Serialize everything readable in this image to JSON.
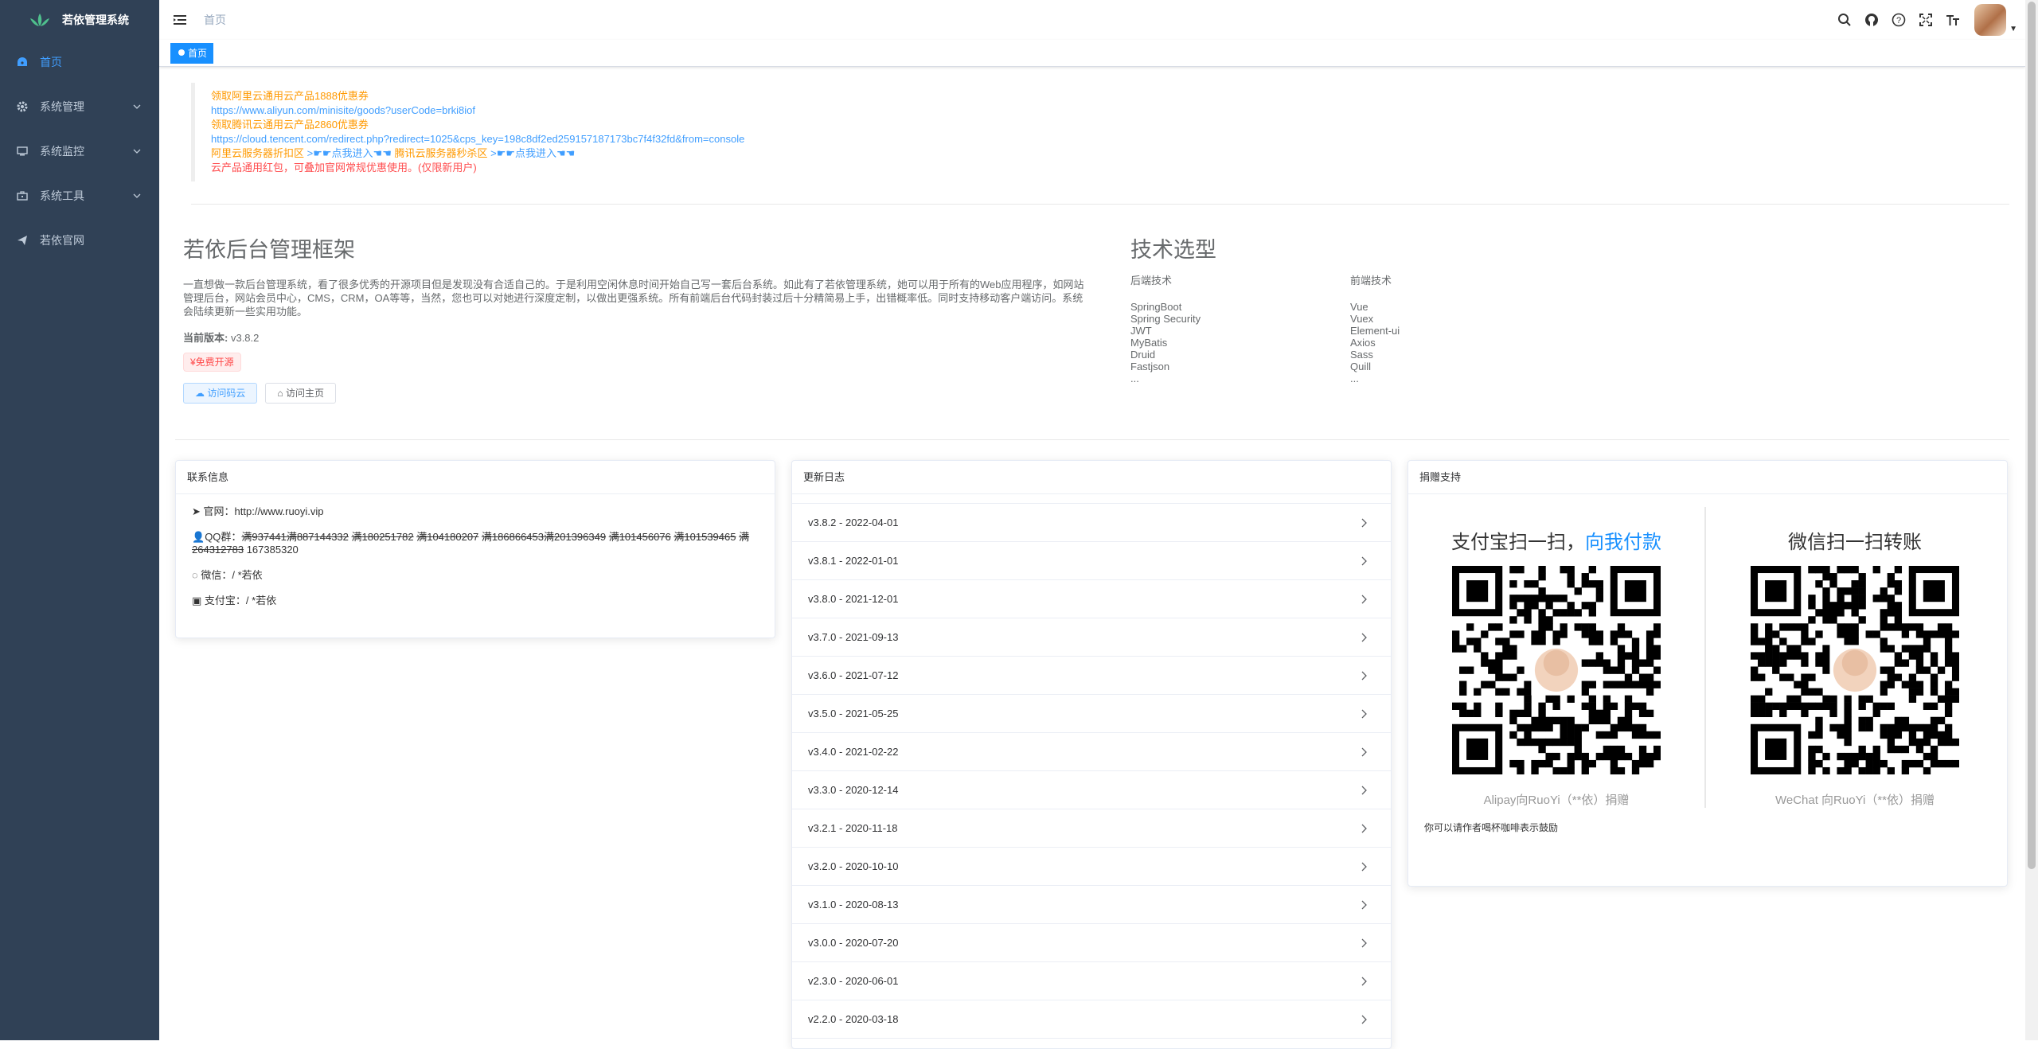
{
  "app": {
    "title": "若依管理系统"
  },
  "sidebar": {
    "items": [
      {
        "label": "首页",
        "icon": "dashboard-icon",
        "active": true,
        "has_arrow": false
      },
      {
        "label": "系统管理",
        "icon": "gear-icon",
        "active": false,
        "has_arrow": true
      },
      {
        "label": "系统监控",
        "icon": "monitor-icon",
        "active": false,
        "has_arrow": true
      },
      {
        "label": "系统工具",
        "icon": "toolbox-icon",
        "active": false,
        "has_arrow": true
      },
      {
        "label": "若依官网",
        "icon": "send-icon",
        "active": false,
        "has_arrow": false
      }
    ]
  },
  "navbar": {
    "breadcrumb": "首页",
    "icons": [
      "search-icon",
      "github-icon",
      "question-icon",
      "fullscreen-icon",
      "font-size-icon"
    ]
  },
  "tags": {
    "active": "首页"
  },
  "notice": {
    "line1": "领取阿里云通用云产品1888优惠券",
    "line2": "https://www.aliyun.com/minisite/goods?userCode=brki8iof",
    "line3": "领取腾讯云通用云产品2860优惠券",
    "line4": "https://cloud.tencent.com/redirect.php?redirect=1025&cps_key=198c8df2ed259157187173bc7f4f32fd&from=console",
    "line5a": "阿里云服务器折扣区",
    "line5b": ">☛☛点我进入☚☚",
    "line5c": "腾讯云服务器秒杀区",
    "line5d": ">☛☛点我进入☚☚",
    "line6": "云产品通用红包，可叠加官网常规优惠使用。(仅限新用户)"
  },
  "intro": {
    "title": "若依后台管理框架",
    "description": "一直想做一款后台管理系统，看了很多优秀的开源项目但是发现没有合适自己的。于是利用空闲休息时间开始自己写一套后台系统。如此有了若依管理系统，她可以用于所有的Web应用程序，如网站管理后台，网站会员中心，CMS，CRM，OA等等，当然，您也可以对她进行深度定制，以做出更强系统。所有前端后台代码封装过后十分精简易上手，出错概率低。同时支持移动客户端访问。系统会陆续更新一些实用功能。",
    "version_label": "当前版本:",
    "version": "v3.8.2",
    "free_tag": "¥免费开源",
    "btn_visit_code": "访问码云",
    "btn_visit_home": "访问主页"
  },
  "tech": {
    "title": "技术选型",
    "backend_header": "后端技术",
    "frontend_header": "前端技术",
    "backend": [
      "SpringBoot",
      "Spring Security",
      "JWT",
      "MyBatis",
      "Druid",
      "Fastjson",
      "..."
    ],
    "frontend": [
      "Vue",
      "Vuex",
      "Element-ui",
      "Axios",
      "Sass",
      "Quill",
      "..."
    ]
  },
  "contact": {
    "header": "联系信息",
    "site_label": "官网：",
    "site": "http://www.ruoyi.vip",
    "qq_label": "QQ群：",
    "qq_struck_1": "满937441",
    "qq_struck_2": "满887144332",
    "qq_struck_3": "满180251782",
    "qq_struck_4": "满104180207",
    "qq_struck_5": "满186866453",
    "qq_struck_6": "满201396349",
    "qq_struck_7": "满101456076",
    "qq_struck_8": "满101539465",
    "qq_struck_9": "满264312783",
    "qq_active": "167385320",
    "wechat_label": "微信：",
    "wechat": "/ *若依",
    "alipay_label": "支付宝：",
    "alipay": "/ *若依"
  },
  "changelog": {
    "header": "更新日志",
    "items": [
      "v3.8.2 - 2022-04-01",
      "v3.8.1 - 2022-01-01",
      "v3.8.0 - 2021-12-01",
      "v3.7.0 - 2021-09-13",
      "v3.6.0 - 2021-07-12",
      "v3.5.0 - 2021-05-25",
      "v3.4.0 - 2021-02-22",
      "v3.3.0 - 2020-12-14",
      "v3.2.1 - 2020-11-18",
      "v3.2.0 - 2020-10-10",
      "v3.1.0 - 2020-08-13",
      "v3.0.0 - 2020-07-20",
      "v2.3.0 - 2020-06-01",
      "v2.2.0 - 2020-03-18"
    ]
  },
  "donate": {
    "header": "捐赠支持",
    "alipay_title_a": "支付宝扫一扫，",
    "alipay_title_b": "向我付款",
    "wechat_title": "微信扫一扫转账",
    "alipay_caption": "Alipay向RuoYi（**依）捐赠",
    "wechat_caption": "WeChat 向RuoYi（**依）捐赠",
    "note": "你可以请作者喝杯咖啡表示鼓励"
  },
  "colors": {
    "sidebar_bg": "#304156",
    "accent": "#409eff",
    "notice_orange": "#ff9900",
    "notice_red": "#ff4d4f",
    "tag_active": "#1890ff"
  }
}
